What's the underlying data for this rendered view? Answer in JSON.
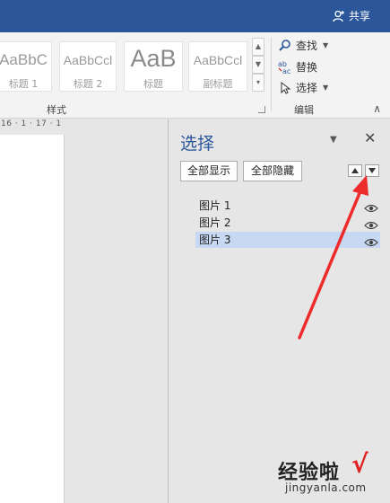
{
  "topbar": {
    "share_label": "共享",
    "share_icon": "user-plus-icon",
    "color": "#2b579a"
  },
  "ribbon": {
    "styles": [
      {
        "sample": "AaBbC",
        "name": "标题 1"
      },
      {
        "sample": "AaBbCcl",
        "name": "标题 2"
      },
      {
        "sample": "AaB",
        "name": "标题"
      },
      {
        "sample": "AaBbCcl",
        "name": "副标题"
      }
    ],
    "styles_group_label": "样式",
    "editing": {
      "find_label": "查找",
      "replace_label": "替换",
      "select_label": "选择",
      "group_label": "编辑"
    }
  },
  "ruler_text": "16 · 1 · 17 · 1",
  "selection_pane": {
    "title": "选择",
    "show_all_label": "全部显示",
    "hide_all_label": "全部隐藏",
    "items": [
      {
        "label": "图片 1",
        "selected": false
      },
      {
        "label": "图片 2",
        "selected": false
      },
      {
        "label": "图片 3",
        "selected": true
      }
    ],
    "selected_color": "#c6d8f2"
  },
  "watermark": {
    "brand": "经验啦",
    "check": "√",
    "url": "jingyanla.com"
  }
}
